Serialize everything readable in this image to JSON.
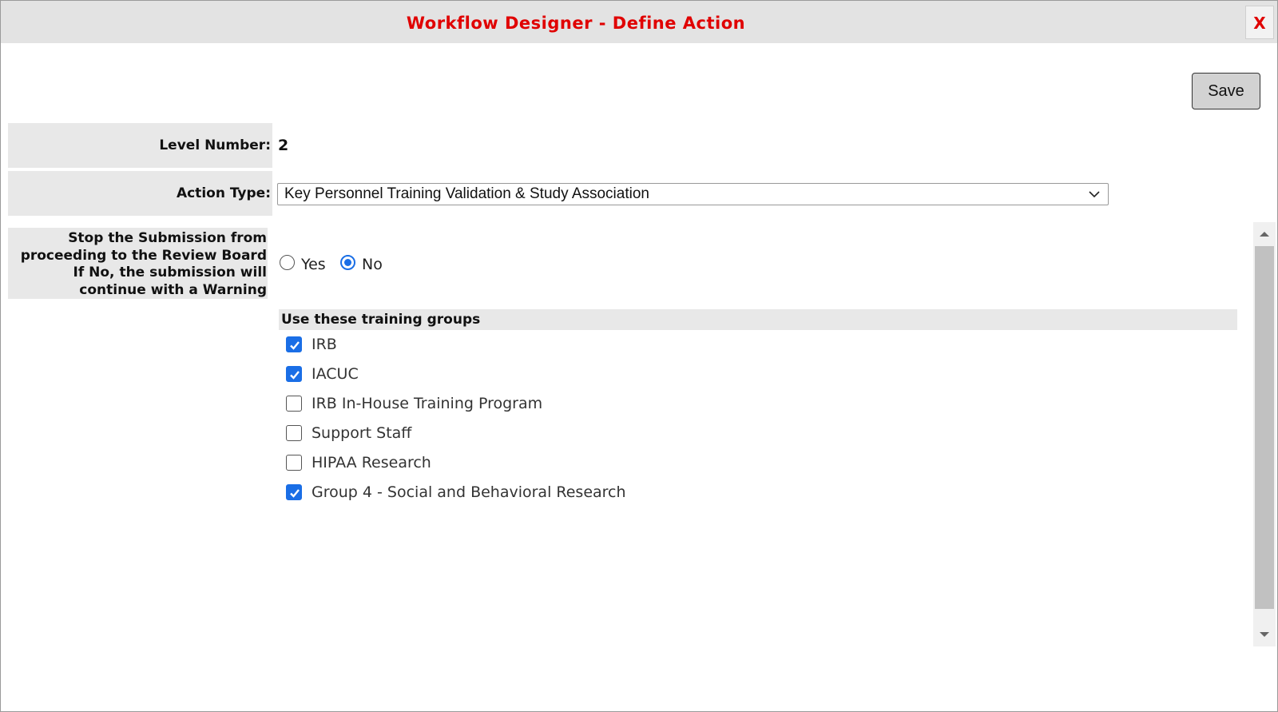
{
  "window": {
    "title": "Workflow Designer - Define Action",
    "close_label": "X"
  },
  "toolbar": {
    "save_label": "Save"
  },
  "form": {
    "level_number_label": "Level Number:",
    "level_number_value": "2",
    "action_type_label": "Action Type:",
    "action_type_value": "Key Personnel Training Validation & Study Association",
    "stop_submission_label_lines": [
      "Stop the Submission from",
      "proceeding to the Review Board",
      "If No, the submission will",
      "continue with a Warning"
    ],
    "stop_submission_options": [
      {
        "label": "Yes",
        "checked": false
      },
      {
        "label": "No",
        "checked": true
      }
    ]
  },
  "training_groups": {
    "header": "Use these training groups",
    "items": [
      {
        "label": "IRB",
        "checked": true
      },
      {
        "label": "IACUC",
        "checked": true
      },
      {
        "label": "IRB In-House Training Program",
        "checked": false
      },
      {
        "label": "Support Staff",
        "checked": false
      },
      {
        "label": "HIPAA Research",
        "checked": false
      },
      {
        "label": "Group 4 - Social and Behavioral Research",
        "checked": true
      }
    ]
  },
  "colors": {
    "title_red": "#e00000",
    "accent_blue": "#1a6ee6",
    "label_bg": "#e8e8e8"
  },
  "icons": {
    "close": "close-icon",
    "dropdown": "chevron-down-icon",
    "scroll_up": "scroll-up-arrow-icon",
    "scroll_down": "scroll-down-arrow-icon",
    "check": "checkmark-icon"
  }
}
